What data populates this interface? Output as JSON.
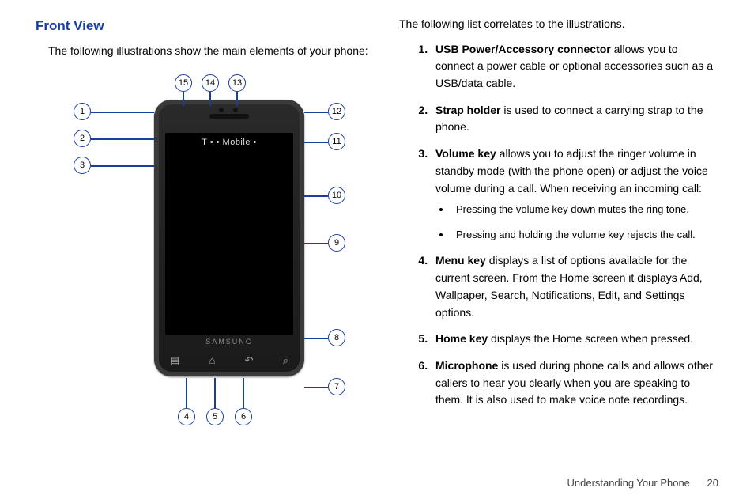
{
  "heading": "Front View",
  "intro": "The following illustrations show the main elements of your phone:",
  "phone": {
    "carrier": "T • • Mobile •",
    "brand": "SAMSUNG"
  },
  "right_intro": "The following list correlates to the illustrations.",
  "items": [
    {
      "term": "USB Power/Accessory connector",
      "desc": " allows you to connect a power cable or optional accessories such as a USB/data cable."
    },
    {
      "term": "Strap holder",
      "desc": " is used to connect a carrying strap to the phone."
    },
    {
      "term": "Volume key",
      "desc": " allows you to adjust the ringer volume in standby mode (with the phone open) or adjust the voice volume during a call. When receiving an incoming call:"
    },
    {
      "term": "Menu key",
      "desc": " displays a list of options available for the current screen. From the Home screen it displays Add, Wallpaper, Search, Notifications, Edit, and Settings options."
    },
    {
      "term": "Home key",
      "desc": " displays the Home screen when pressed."
    },
    {
      "term": "Microphone",
      "desc": " is used during phone calls and allows other callers to hear you clearly when you are speaking to them. It is also used to make voice note recordings."
    }
  ],
  "volume_bullets": [
    "Pressing the volume key down mutes the ring tone.",
    "Pressing and holding the volume key rejects the call."
  ],
  "callouts": [
    "1",
    "2",
    "3",
    "4",
    "5",
    "6",
    "7",
    "8",
    "9",
    "10",
    "11",
    "12",
    "13",
    "14",
    "15"
  ],
  "nav_icons": [
    "menu-icon",
    "home-icon",
    "back-icon",
    "search-icon"
  ],
  "footer_section": "Understanding Your Phone",
  "footer_page": "20"
}
